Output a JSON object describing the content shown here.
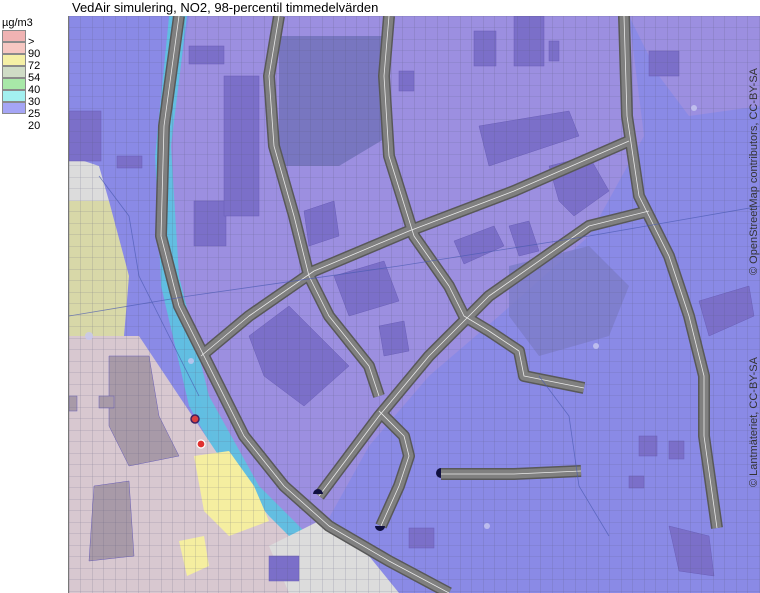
{
  "map_title": "VedAir simulering, NO2, 98-percentil timmedelvärden",
  "legend": {
    "unit": "µg/m3",
    "entries": [
      {
        "label": ">",
        "color": "#f0b3b3"
      },
      {
        "label": "90",
        "color": "#f6c7c2"
      },
      {
        "label": "72",
        "color": "#f5f0a6"
      },
      {
        "label": "54",
        "color": "#cfdcc6"
      },
      {
        "label": "40",
        "color": "#a8e8a8"
      },
      {
        "label": "30",
        "color": "#a3f0f0"
      },
      {
        "label": "25",
        "color": "#a5a5f5"
      },
      {
        "label": "20",
        "color": "#ffffff"
      }
    ]
  },
  "attribution": {
    "osm": "© OpenStreetMap contributors, CC-BY-SA",
    "lantmateriet": "© Lantmäteriet, CC-BY-SA"
  },
  "colors": {
    "background_low": "#8a8ae6",
    "zone_violet": "#9c8fe0",
    "zone_cyan": "#59c7e0",
    "zone_pink": "#d8c8d0",
    "zone_yellow": "#f5eea0",
    "zone_olive": "#d8d8a8",
    "zone_grey": "#dcdcdc",
    "building": "#7b6fc9",
    "road": "#808080",
    "grid": "#6a6a8a"
  }
}
